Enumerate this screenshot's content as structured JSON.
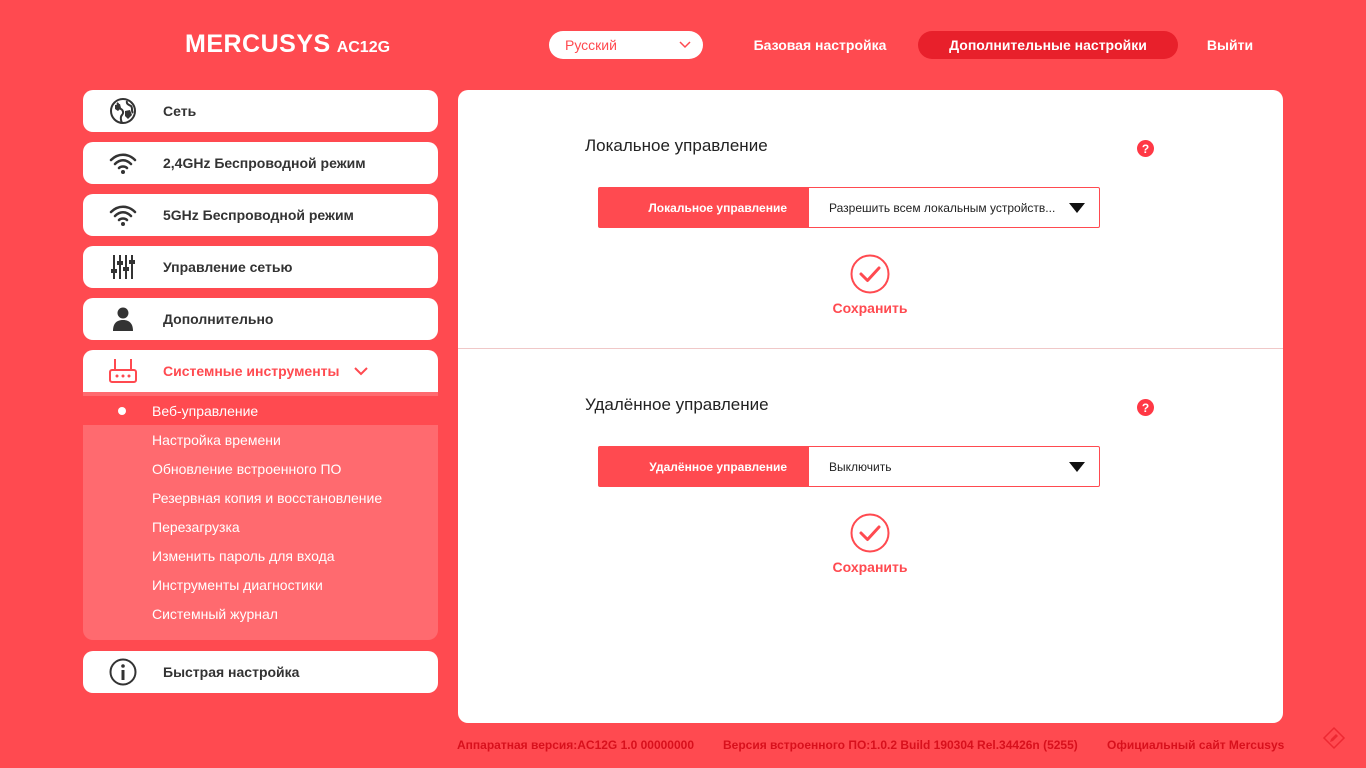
{
  "header": {
    "brand": "MERCUSYS",
    "model": "AC12G",
    "language": "Русский",
    "nav_basic": "Базовая настройка",
    "nav_advanced": "Дополнительные настройки",
    "nav_exit": "Выйти"
  },
  "sidebar": {
    "items": [
      {
        "label": "Сеть",
        "icon": "globe-icon"
      },
      {
        "label": "2,4GHz Беспроводной режим",
        "icon": "wifi-icon"
      },
      {
        "label": "5GHz Беспроводной режим",
        "icon": "wifi-icon"
      },
      {
        "label": "Управление сетью",
        "icon": "sliders-icon"
      },
      {
        "label": "Дополнительно",
        "icon": "user-icon"
      },
      {
        "label": "Системные инструменты",
        "icon": "router-icon"
      },
      {
        "label": "Быстрая настройка",
        "icon": "info-icon"
      }
    ],
    "submenu": [
      "Веб-управление",
      "Настройка времени",
      "Обновление встроенного ПО",
      "Резервная копия и восстановление",
      "Перезагрузка",
      "Изменить пароль для входа",
      "Инструменты диагностики",
      "Системный журнал"
    ]
  },
  "local": {
    "title": "Локальное управление",
    "field_label": "Локальное управление",
    "value": "Разрешить всем локальным устройств...",
    "save": "Сохранить"
  },
  "remote": {
    "title": "Удалённое управление",
    "field_label": "Удалённое управление",
    "value": "Выключить",
    "save": "Сохранить"
  },
  "help_symbol": "?",
  "footer": {
    "hardware": "Аппаратная версия:AC12G 1.0 00000000",
    "firmware": "Версия встроенного ПО:1.0.2 Build 190304 Rel.34426n (5255)",
    "site": "Официальный сайт Mercusys"
  },
  "colors": {
    "background": "#ff4a50",
    "accent_dark": "#e8202b",
    "submenu_bg": "#ff6a6f",
    "text_dark": "#333333"
  }
}
